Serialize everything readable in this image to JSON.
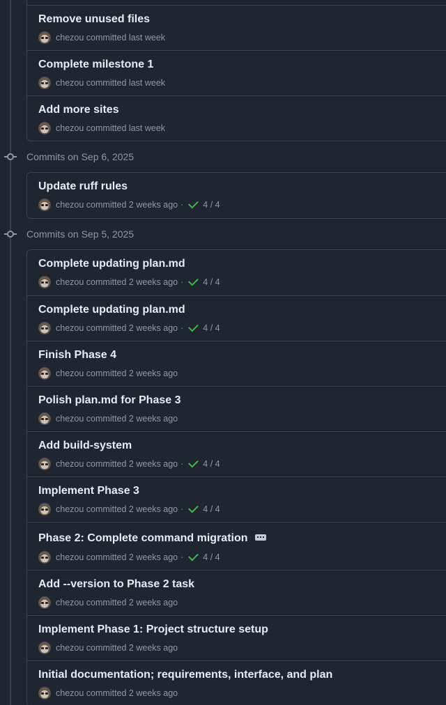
{
  "groups": [
    {
      "header": "",
      "commits": [
        {
          "title": "Remove unused files",
          "author": "chezou",
          "committed": "committed last week",
          "checks": ""
        },
        {
          "title": "Complete milestone 1",
          "author": "chezou",
          "committed": "committed last week",
          "checks": ""
        },
        {
          "title": "Add more sites",
          "author": "chezou",
          "committed": "committed last week",
          "checks": ""
        }
      ]
    },
    {
      "header": "Commits on Sep 6, 2025",
      "commits": [
        {
          "title": "Update ruff rules",
          "author": "chezou",
          "committed": "committed 2 weeks ago",
          "checks": "4 / 4"
        }
      ]
    },
    {
      "header": "Commits on Sep 5, 2025",
      "commits": [
        {
          "title": "Complete updating plan.md",
          "author": "chezou",
          "committed": "committed 2 weeks ago",
          "checks": "4 / 4"
        },
        {
          "title": "Complete updating plan.md",
          "author": "chezou",
          "committed": "committed 2 weeks ago",
          "checks": "4 / 4"
        },
        {
          "title": "Finish Phase 4",
          "author": "chezou",
          "committed": "committed 2 weeks ago",
          "checks": ""
        },
        {
          "title": "Polish plan.md for Phase 3",
          "author": "chezou",
          "committed": "committed 2 weeks ago",
          "checks": ""
        },
        {
          "title": "Add build-system",
          "author": "chezou",
          "committed": "committed 2 weeks ago",
          "checks": "4 / 4"
        },
        {
          "title": "Implement Phase 3",
          "author": "chezou",
          "committed": "committed 2 weeks ago",
          "checks": "4 / 4"
        },
        {
          "title": "Phase 2: Complete command migration",
          "author": "chezou",
          "committed": "committed 2 weeks ago",
          "checks": "4 / 4",
          "has_more": true
        },
        {
          "title": "Add --version to Phase 2 task",
          "author": "chezou",
          "committed": "committed 2 weeks ago",
          "checks": ""
        },
        {
          "title": "Implement Phase 1: Project structure setup",
          "author": "chezou",
          "committed": "committed 2 weeks ago",
          "checks": ""
        },
        {
          "title": "Initial documentation; requirements, interface, and plan",
          "author": "chezou",
          "committed": "committed 2 weeks ago",
          "checks": ""
        }
      ]
    }
  ],
  "icons": {
    "avatar": "avatar",
    "check": "check-icon",
    "commit_node": "git-commit-icon",
    "more": "ellipsis-icon"
  },
  "colors": {
    "background": "#212530",
    "border": "#3d444d",
    "text_primary": "#e6edf3",
    "text_muted": "#9198a1",
    "success": "#3fb950"
  }
}
